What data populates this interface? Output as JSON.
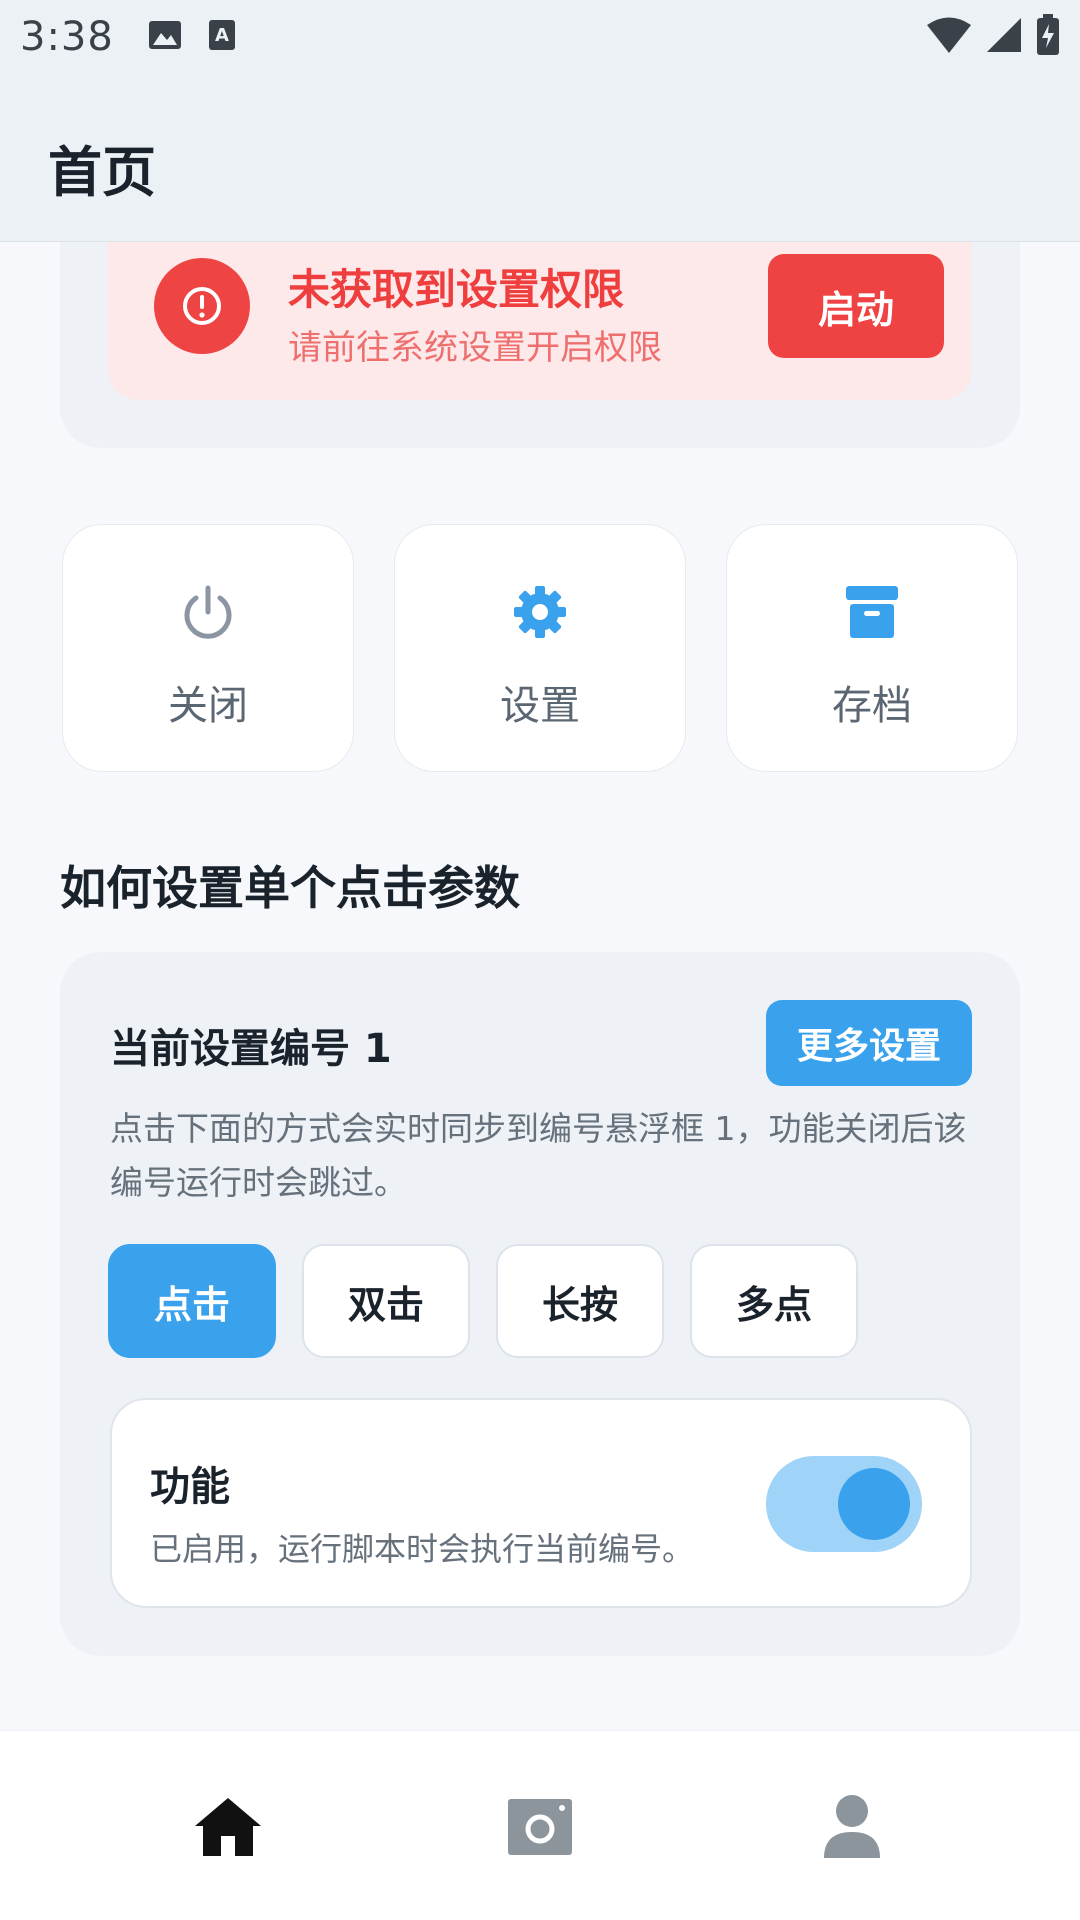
{
  "status_bar": {
    "time": "3:38",
    "left_icons": [
      "image-icon",
      "text-a-icon"
    ],
    "right_icons": [
      "wifi-icon",
      "cell-signal-icon",
      "battery-charging-icon"
    ]
  },
  "app_bar": {
    "title": "首页"
  },
  "permission": {
    "icon": "alert-circle-icon",
    "title": "未获取到设置权限",
    "subtitle": "请前往系统设置开启权限",
    "button_label": "启动",
    "accent": "#ef4444"
  },
  "actions": [
    {
      "label": "关闭",
      "icon": "power-icon"
    },
    {
      "label": "设置",
      "icon": "gear-icon"
    },
    {
      "label": "存档",
      "icon": "archive-icon"
    }
  ],
  "section": {
    "title": "如何设置单个点击参数"
  },
  "settings": {
    "title": "当前设置编号 1",
    "more_label": "更多设置",
    "description": "点击下面的方式会实时同步到编号悬浮框 1，功能关闭后该编号运行时会跳过。",
    "modes": [
      {
        "label": "点击",
        "active": true
      },
      {
        "label": "双击",
        "active": false
      },
      {
        "label": "长按",
        "active": false
      },
      {
        "label": "多点",
        "active": false
      }
    ],
    "feature": {
      "title": "功能",
      "description": "已启用，运行脚本时会执行当前编号。",
      "enabled": true
    },
    "accent": "#3aa2ec"
  },
  "bottom_nav": {
    "items": [
      {
        "icon": "home-icon",
        "active": true
      },
      {
        "icon": "camera-icon",
        "active": false
      },
      {
        "icon": "user-icon",
        "active": false
      }
    ]
  }
}
